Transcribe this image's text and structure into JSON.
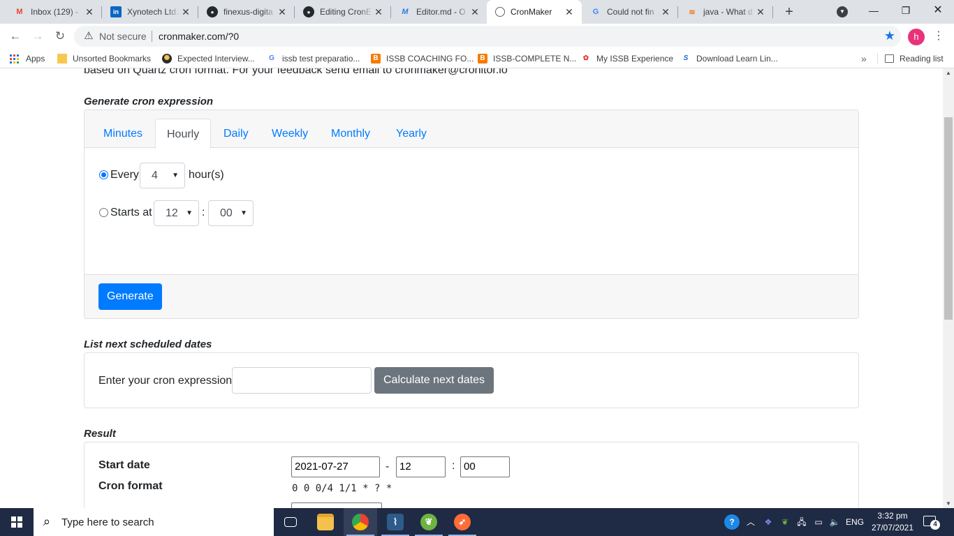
{
  "browser": {
    "tabs": [
      {
        "title": "Inbox (129) - ",
        "favicon": "gmail-icon"
      },
      {
        "title": "Xynotech Ltd.: ",
        "favicon": "linkedin-icon"
      },
      {
        "title": "finexus-digita",
        "favicon": "github-icon"
      },
      {
        "title": "Editing CronE",
        "favicon": "github-icon"
      },
      {
        "title": "Editor.md - O",
        "favicon": "editormd-icon"
      },
      {
        "title": "CronMaker",
        "favicon": "globe-icon"
      },
      {
        "title": "Could not fin",
        "favicon": "google-icon"
      },
      {
        "title": "java - What d",
        "favicon": "stackoverflow-icon"
      }
    ],
    "security_label": "Not secure",
    "url": "cronmaker.com/?0",
    "profile_initial": "h",
    "bookmarks": [
      "Apps",
      "Unsorted Bookmarks",
      "Expected Interview...",
      "issb test preparatio...",
      "ISSB COACHING FO...",
      "ISSB-COMPLETE N...",
      "My ISSB Experience",
      "Download Learn Lin..."
    ],
    "reading_list": "Reading list",
    "colors": {
      "accent": "#1a73e8",
      "profile": "#e8337a"
    }
  },
  "page": {
    "intro_text": "based on Quartz cron format. For your feedback send email to cronmaker@cronitor.io",
    "generate_title": "Generate cron expression",
    "tabs": [
      "Minutes",
      "Hourly",
      "Daily",
      "Weekly",
      "Monthly",
      "Yearly"
    ],
    "active_tab": "Hourly",
    "every_label": "Every",
    "every_value": "4",
    "hours_suffix": "hour(s)",
    "starts_label": "Starts at",
    "start_hour": "12",
    "time_separator": ":",
    "start_minute": "00",
    "generate_button": "Generate",
    "list_title": "List next scheduled dates",
    "enter_label": "Enter your cron expression",
    "cron_input_value": "",
    "calculate_button": "Calculate next dates",
    "result_title": "Result",
    "start_date_label": "Start date",
    "start_date_value": "2021-07-27",
    "date_separator": "-",
    "result_hour": "12",
    "result_minute": "00",
    "cron_format_label": "Cron format",
    "cron_format_value": "0 0 0/4 1/1 * ? *",
    "colors": {
      "primary": "#007bff",
      "secondary": "#6c757d"
    }
  },
  "taskbar": {
    "search_placeholder": "Type here to search",
    "language": "ENG",
    "time": "3:32 pm",
    "date": "27/07/2021",
    "notifications": "4"
  }
}
